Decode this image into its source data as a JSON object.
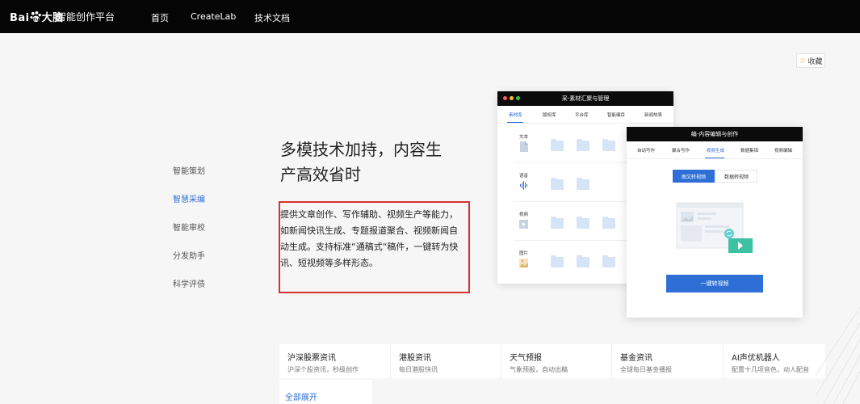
{
  "header": {
    "logo_text": "Bai",
    "logo_cn": "大脑",
    "product_name": "智能创作平台",
    "nav": [
      "首页",
      "CreateLab",
      "技术文档"
    ]
  },
  "favorite": {
    "label": "收藏"
  },
  "sidebar": {
    "items": [
      {
        "label": "智能策划",
        "active": false
      },
      {
        "label": "智慧采编",
        "active": true
      },
      {
        "label": "智能审校",
        "active": false
      },
      {
        "label": "分发助手",
        "active": false
      },
      {
        "label": "科学评债",
        "active": false
      }
    ]
  },
  "main": {
    "headline_line1": "多模技术加持，内容生",
    "headline_line2": "产高效省时",
    "description": "提供文章创作、写作辅助、视频生产等能力，如新闻快讯生成、专题报道聚合、视频新闻自动生成。支持标准“通稿式“稿件，一键转为快讯、短视频等多样形态。"
  },
  "mockup1": {
    "title": "采-素材汇聚与管理",
    "tabs": [
      "素材库",
      "版权库",
      "平台库",
      "智能编目",
      "新闻热表"
    ],
    "rows": [
      "文本",
      "语音",
      "视频",
      "图片"
    ]
  },
  "mockup2": {
    "title": "编-内容编辑与创作",
    "tabs": [
      "自动写作",
      "聚合写作",
      "视频生成",
      "数据集锦",
      "视频编辑"
    ],
    "toggle_active": "图文转视频",
    "toggle_other": "数据转视频",
    "action": "一键转视频"
  },
  "cards": [
    {
      "title": "沪深股票资讯",
      "desc": "沪深个股资讯，秒级创作"
    },
    {
      "title": "港股资讯",
      "desc": "每日港股快讯"
    },
    {
      "title": "天气预报",
      "desc": "气象预报，自动出稿"
    },
    {
      "title": "基金资讯",
      "desc": "全球每日基金播报"
    },
    {
      "title": "AI声优机器人",
      "desc": "配置十几项音色，动人配音"
    }
  ],
  "expand_all": "全部展开",
  "colors": {
    "accent": "#2d6fd6",
    "highlight_border": "#d73030",
    "topbar": "#050505"
  }
}
